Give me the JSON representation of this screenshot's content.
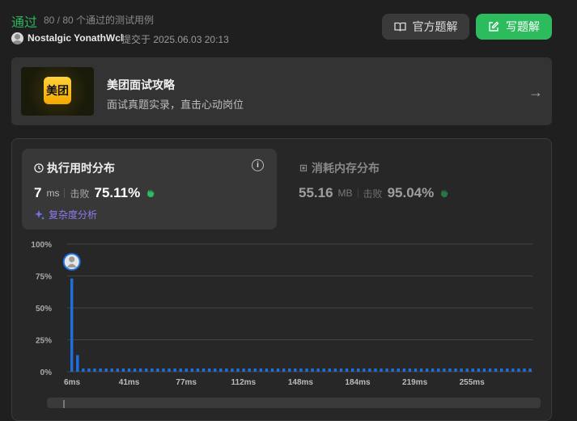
{
  "header": {
    "status": "通过",
    "count": "80 / 80 个通过的测试用例",
    "user": "Nostalgic YonathWcl",
    "submitted": "提交于 2025.06.03 20:13",
    "official_btn": "官方题解",
    "write_btn": "写题解"
  },
  "banner": {
    "logo_text": "美团",
    "title": "美团面试攻略",
    "subtitle": "面试真题实录，直击心动岗位"
  },
  "runtime": {
    "title": "执行用时分布",
    "value": "7",
    "unit": "ms",
    "beat_label": "击败",
    "beat": "75.11%",
    "complexity": "复杂度分析"
  },
  "memory": {
    "title": "消耗内存分布",
    "value": "55.16",
    "unit": "MB",
    "beat_label": "击败",
    "beat": "95.04%"
  },
  "colors": {
    "accent_green": "#2cbb5d",
    "bar_blue": "#1e6fe0"
  },
  "chart_data": {
    "type": "bar",
    "y_ticks": [
      "100%",
      "75%",
      "50%",
      "25%",
      "0%"
    ],
    "x_ticks": [
      "6ms",
      "41ms",
      "77ms",
      "112ms",
      "148ms",
      "184ms",
      "219ms",
      "255ms"
    ],
    "ylim": [
      0,
      100
    ],
    "values": [
      73,
      13,
      2.5,
      2.5,
      2.5,
      2.5,
      2.5,
      2.5,
      2.5,
      2.5,
      2.5,
      2.5,
      2.5,
      2.5,
      2.5,
      2.5,
      2.5,
      2.5,
      2.5,
      2.5,
      2.5,
      2.5,
      2.5,
      2.5,
      2.5,
      2.5,
      2.5,
      2.5,
      2.5,
      2.5,
      2.5,
      2.5,
      2.5,
      2.5,
      2.5,
      2.5,
      2.5,
      2.5,
      2.5,
      2.5,
      2.5,
      2.5,
      2.5,
      2.5,
      2.5,
      2.5,
      2.5,
      2.5,
      2.5,
      2.5,
      2.5,
      2.5,
      2.5,
      2.5,
      2.5,
      2.5,
      2.5,
      2.5,
      2.5,
      2.5,
      2.5,
      2.5,
      2.5,
      2.5,
      2.5,
      2.5,
      2.5,
      2.5,
      2.5,
      2.5,
      2.5,
      2.5,
      2.5,
      2.5,
      2.5,
      2.5,
      2.5,
      2.5,
      2.5,
      2.5,
      2.5
    ],
    "highlight_index": 0
  }
}
